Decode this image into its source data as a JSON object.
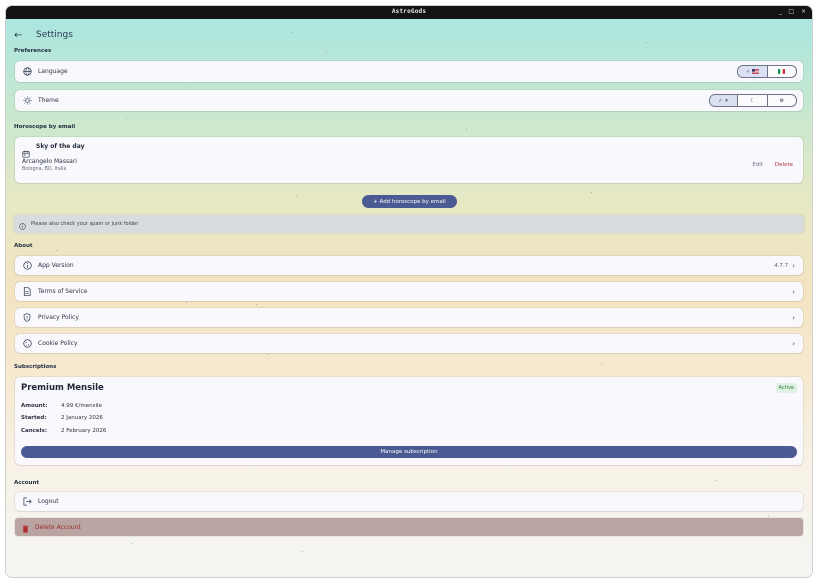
{
  "window": {
    "title": "AstroGods",
    "controls": [
      "_",
      "□",
      "×"
    ]
  },
  "header": {
    "back_icon": "arrow-left-icon",
    "title": "Settings"
  },
  "preferences": {
    "label": "Preferences",
    "language": {
      "label": "Language",
      "icon": "globe-icon",
      "options": [
        "✓",
        "IT"
      ],
      "selected": "English (US)"
    },
    "theme": {
      "label": "Theme",
      "icon": "sun-icon",
      "options": [
        "light",
        "dark",
        "system"
      ],
      "selected": "light"
    }
  },
  "horoscope": {
    "label": "Horoscope by email",
    "card": {
      "title": "Sky of the day",
      "name": "Arcangelo Massari",
      "location": "Bologna, BO, Italia",
      "edit_label": "Edit",
      "delete_label": "Delete"
    },
    "add_button": "+ Add horoscope by email",
    "notice": "Please also check your spam or junk folder"
  },
  "about": {
    "label": "About",
    "items": [
      {
        "label": "App Version",
        "icon": "info-icon",
        "value": "4.7.7"
      },
      {
        "label": "Terms of Service",
        "icon": "document-icon",
        "value": ""
      },
      {
        "label": "Privacy Policy",
        "icon": "shield-icon",
        "value": ""
      },
      {
        "label": "Cookie Policy",
        "icon": "cookie-icon",
        "value": ""
      }
    ]
  },
  "subscriptions": {
    "label": "Subscriptions",
    "plan": "Premium Mensile",
    "status": "Active",
    "amount_label": "Amount:",
    "amount": "4.99 €/mensile",
    "started_label": "Started:",
    "started": "2 January 2026",
    "cancels_label": "Cancels:",
    "cancels": "2 February 2026",
    "manage_button": "Manage subscription"
  },
  "account": {
    "label": "Account",
    "logout": "Logout",
    "delete": "Delete Account"
  },
  "colors": {
    "accent": "#4a5a93",
    "danger_text": "#9d2c2c",
    "active_badge": "#2d7a3b"
  }
}
